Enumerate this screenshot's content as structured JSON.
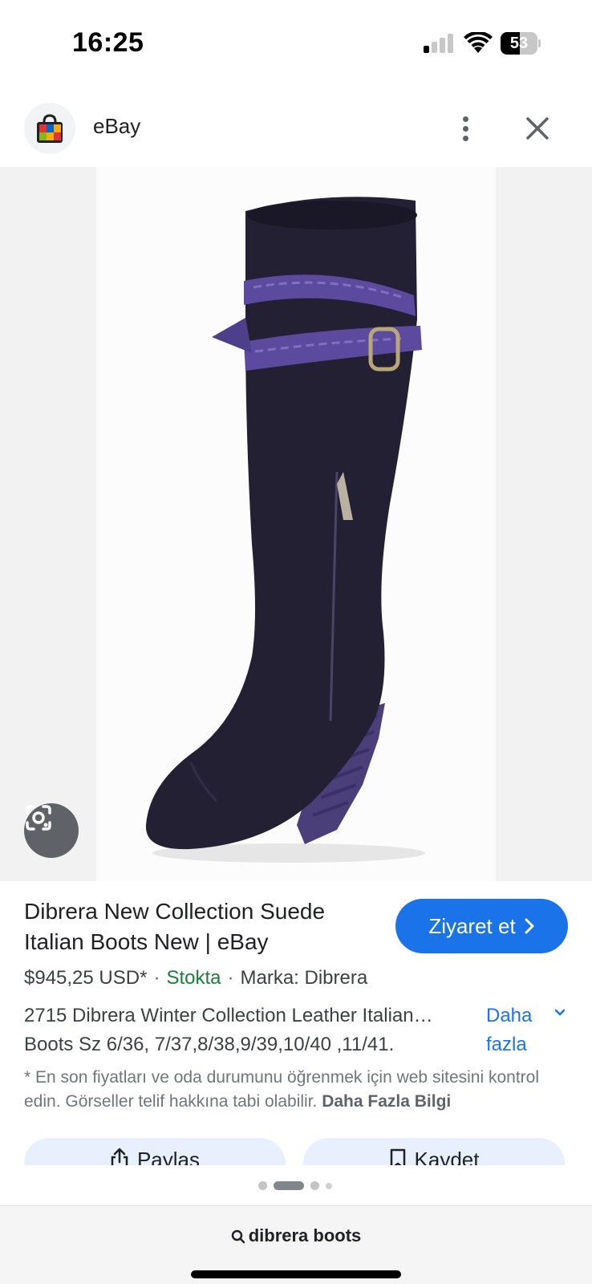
{
  "status_bar": {
    "time": "16:25",
    "battery_level": "53",
    "signal_bars_active": 1,
    "signal_bars_total": 4
  },
  "header": {
    "site_name": "eBay",
    "logo_icon": "shopping-bag-icon",
    "more_icon": "more-vert-icon",
    "close_icon": "close-icon"
  },
  "image": {
    "subject_icon": "boot-product-photo",
    "lens_icon": "google-lens-icon"
  },
  "product": {
    "title": "Dibrera New Collection Suede Italian Boots New | eBay",
    "visit_label": "Ziyaret et",
    "price": "$945,25 USD*",
    "stock": "Stokta",
    "brand": "Marka: Dibrera",
    "description_line1": "2715 Dibrera Winter Collection Leather Italian…",
    "description_line2": "Boots Sz 6/36, 7/37,8/38,9/39,10/40 ,11/41.",
    "more_label_line1": "Daha",
    "more_label_line2": "fazla",
    "disclaimer": "* En son fiyatları ve oda durumunu öğrenmek için web sitesini kontrol edin. Görseller telif hakkına tabi olabilir.",
    "disclaimer_link": "Daha Fazla Bilgi"
  },
  "actions": {
    "share_label": "Paylaş",
    "save_label": "Kaydet"
  },
  "pagination": {
    "active_index": 1,
    "count": 4
  },
  "bottom": {
    "search_query": "dibrera boots"
  },
  "colors": {
    "accent": "#1a73e8",
    "stock_green": "#188038",
    "boot": "#232033",
    "strap": "#5b4a9e"
  }
}
